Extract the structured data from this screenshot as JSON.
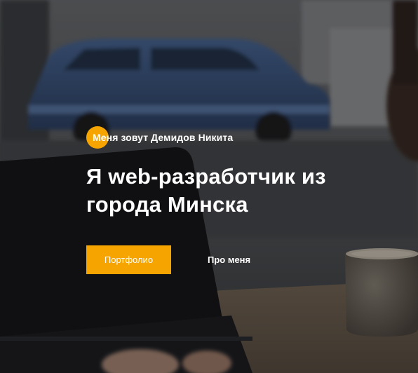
{
  "hero": {
    "subtitle": "Меня зовут Демидов Никита",
    "headline_line1": "Я web-разработчик из",
    "headline_line2": "города Минска",
    "primary_button": "Портфолио",
    "secondary_link": "Про меня"
  },
  "colors": {
    "accent": "#f5a400",
    "text": "#ffffff"
  }
}
